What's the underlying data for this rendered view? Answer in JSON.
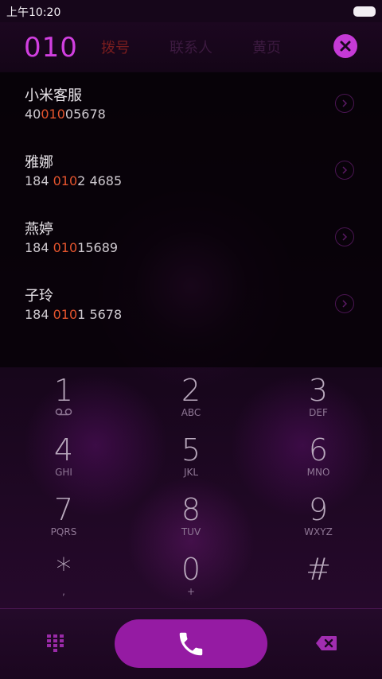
{
  "status_bar": {
    "time": "上午10:20"
  },
  "header": {
    "query": "010",
    "tabs": [
      {
        "label": "拨号"
      },
      {
        "label": "联系人"
      },
      {
        "label": "黄页"
      }
    ]
  },
  "results": [
    {
      "name": "小米客服",
      "num_pre": "40",
      "num_match": "010",
      "num_post": "05678"
    },
    {
      "name": "雅娜",
      "num_pre": "184 ",
      "num_match": "010",
      "num_post": "2 4685"
    },
    {
      "name": "燕婷",
      "num_pre": "184 ",
      "num_match": "010",
      "num_post": "15689"
    },
    {
      "name": "子玲",
      "num_pre": "184 ",
      "num_match": "010",
      "num_post": "1 5678"
    }
  ],
  "keypad": [
    {
      "digit": "1",
      "sub": ""
    },
    {
      "digit": "2",
      "sub": "ABC"
    },
    {
      "digit": "3",
      "sub": "DEF"
    },
    {
      "digit": "4",
      "sub": "GHI"
    },
    {
      "digit": "5",
      "sub": "JKL"
    },
    {
      "digit": "6",
      "sub": "MNO"
    },
    {
      "digit": "7",
      "sub": "PQRS"
    },
    {
      "digit": "8",
      "sub": "TUV"
    },
    {
      "digit": "9",
      "sub": "WXYZ"
    },
    {
      "digit": "*",
      "sub": ","
    },
    {
      "digit": "0",
      "sub": "+"
    },
    {
      "digit": "#",
      "sub": ""
    }
  ],
  "icons": {
    "clear": "close-icon",
    "result_arrow": "chevron-right-icon",
    "voicemail": "voicemail-icon",
    "dialpad": "dialpad-icon",
    "call": "phone-icon",
    "backspace": "backspace-icon"
  },
  "colors": {
    "accent": "#c53ad6",
    "match": "#e4542d",
    "call_button": "#951ba3"
  }
}
